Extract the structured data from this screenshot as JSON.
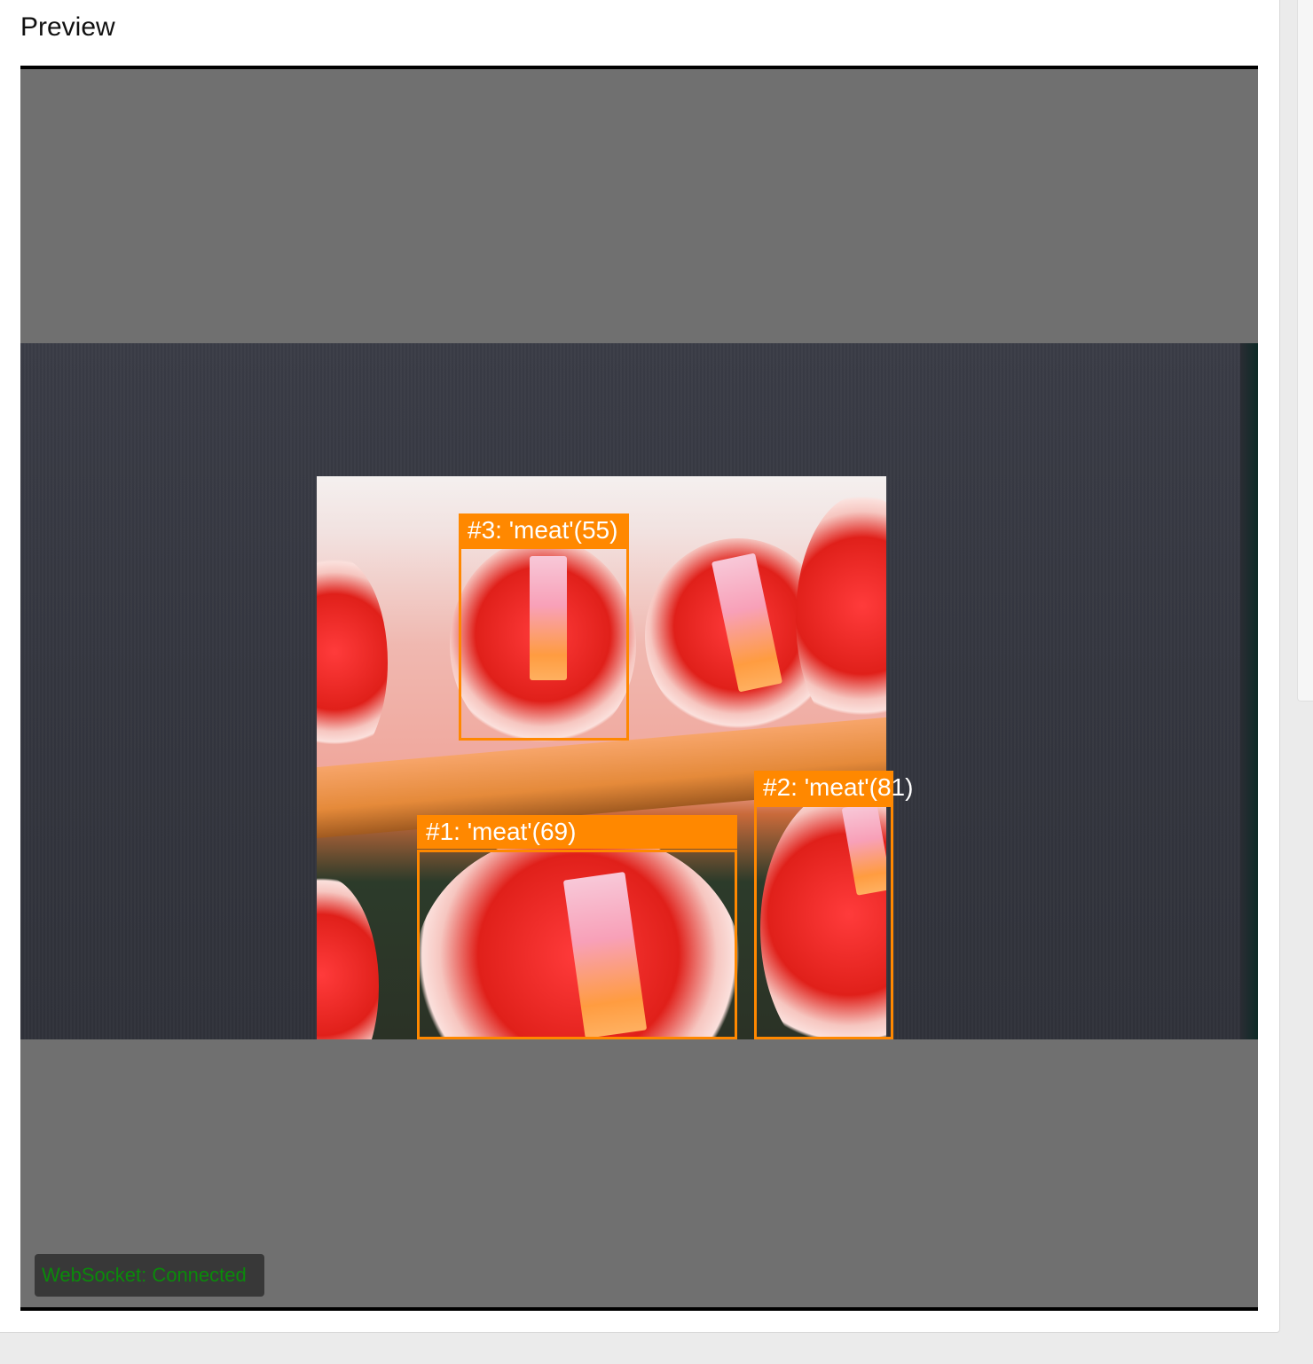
{
  "panel": {
    "title": "Preview"
  },
  "detections": [
    {
      "label": "#1: 'meat'(69)",
      "class": "meat",
      "score": 69
    },
    {
      "label": "#2: 'meat'(81)",
      "class": "meat",
      "score": 81
    },
    {
      "label": "#3: 'meat'(55)",
      "class": "meat",
      "score": 55
    }
  ],
  "status": {
    "text": "WebSocket: Connected",
    "color": "#0a8a0a"
  },
  "colors": {
    "box": "#ff8800",
    "viewport_bg": "#707070"
  }
}
